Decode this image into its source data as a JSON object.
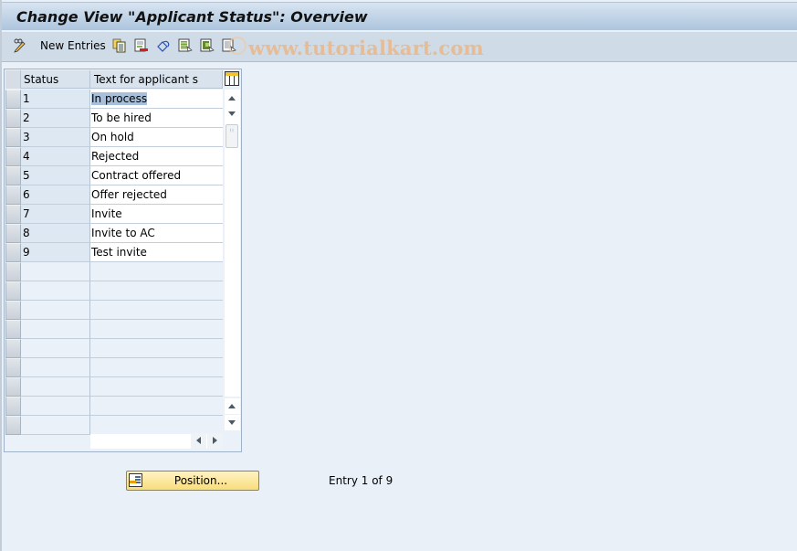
{
  "window": {
    "title": "Change View \"Applicant Status\": Overview"
  },
  "toolbar": {
    "new_entries_label": "New Entries",
    "icons": [
      {
        "name": "edit-toggle-icon"
      },
      {
        "name": "copy-as-icon"
      },
      {
        "name": "delete-icon"
      },
      {
        "name": "undo-change-icon"
      },
      {
        "name": "select-all-icon"
      },
      {
        "name": "select-block-icon"
      },
      {
        "name": "deselect-all-icon"
      }
    ]
  },
  "watermark": {
    "text": "www.tutorialkart.com",
    "color": "#e8b98e"
  },
  "table": {
    "columns": [
      {
        "label": "Status"
      },
      {
        "label": "Text for applicant s"
      }
    ],
    "rows": [
      {
        "status": "1",
        "text": "In process",
        "selected_text": true
      },
      {
        "status": "2",
        "text": "To be hired"
      },
      {
        "status": "3",
        "text": "On hold"
      },
      {
        "status": "4",
        "text": "Rejected"
      },
      {
        "status": "5",
        "text": "Contract offered"
      },
      {
        "status": "6",
        "text": "Offer rejected"
      },
      {
        "status": "7",
        "text": "Invite"
      },
      {
        "status": "8",
        "text": "Invite to AC"
      },
      {
        "status": "9",
        "text": "Test invite"
      }
    ],
    "empty_row_count": 9
  },
  "footer": {
    "position_button_label": "Position...",
    "entry_info": "Entry 1 of 9"
  },
  "colors": {
    "title_bar": "#adc5dd",
    "toolbar": "#cfdce8",
    "background": "#e9f0f7",
    "highlight": "#a7bfd9",
    "position_button": "#f8dd7c"
  }
}
